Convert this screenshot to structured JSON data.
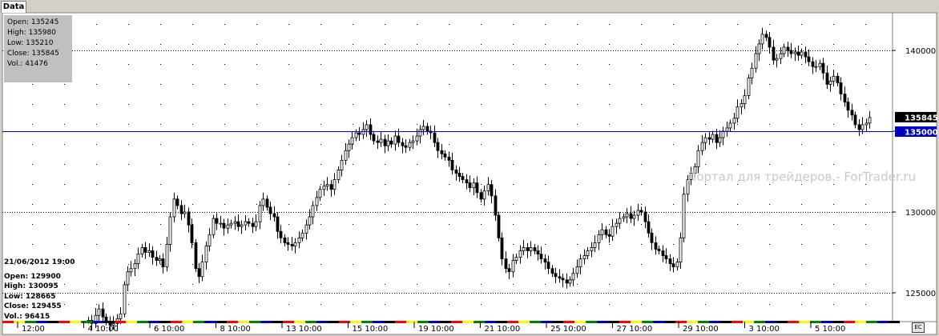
{
  "tab": {
    "label": "Data"
  },
  "data_box": {
    "rows": [
      {
        "label": "Open",
        "value": "135245"
      },
      {
        "label": "High",
        "value": "135980"
      },
      {
        "label": "Low",
        "value": "135210"
      },
      {
        "label": "Close",
        "value": "135845"
      },
      {
        "label": "Vol.",
        "value": "41476"
      }
    ]
  },
  "bar_info": {
    "date": "21/06/2012 19:00",
    "rows": [
      {
        "label": "Open",
        "value": "129900"
      },
      {
        "label": "High",
        "value": "130095"
      },
      {
        "label": "Low",
        "value": "128665"
      },
      {
        "label": "Close",
        "value": "129455"
      },
      {
        "label": "Vol.",
        "value": "96415"
      }
    ]
  },
  "watermark": "Портал для трейдеров.- ForTrader.ru",
  "corner_button": "EC",
  "colors": {
    "background": "#ffffff",
    "candle": "#000000",
    "level_line": "#0000c0",
    "current_price_bg": "#000000",
    "level_price_bg": "#0000c0"
  },
  "chart_data": {
    "type": "candlestick",
    "ylim": [
      123000,
      147000
    ],
    "y_ticks": [
      125000,
      130000,
      135000,
      140000
    ],
    "y_tick_labels": [
      "125000",
      "130000",
      "135000",
      "140000"
    ],
    "x_tick_labels": [
      "12:00",
      "4 10:00",
      "6 10:00",
      "8 10:00",
      "13 10:00",
      "15 10:00",
      "19 10:00",
      "21 10:00",
      "25 10:00",
      "27 10:00",
      "29 10:00",
      "3 10:00",
      "5 10:00"
    ],
    "current_price": 135845,
    "current_price_label": "135845",
    "level": 135000,
    "level_label": "135000",
    "grid": true,
    "close_series": [
      123300,
      123100,
      123600,
      124000,
      123500,
      123200,
      123000,
      123100,
      123400,
      123700,
      125500,
      126300,
      126500,
      126800,
      127400,
      127800,
      127500,
      127600,
      127200,
      127000,
      127100,
      126600,
      128000,
      129700,
      130800,
      130400,
      129900,
      130000,
      129200,
      128100,
      126500,
      126000,
      126900,
      127900,
      128600,
      129600,
      129300,
      129300,
      129000,
      129200,
      129300,
      129400,
      129100,
      129200,
      129400,
      129300,
      129100,
      129400,
      130400,
      130800,
      130300,
      129900,
      129700,
      128800,
      128400,
      128100,
      128000,
      127900,
      128100,
      128400,
      128700,
      129200,
      129700,
      130400,
      130900,
      131400,
      131600,
      131700,
      131400,
      132000,
      132600,
      133200,
      133800,
      134200,
      134600,
      134900,
      134800,
      135100,
      135400,
      134800,
      134400,
      134300,
      134500,
      134100,
      134400,
      134200,
      134700,
      134300,
      134100,
      134000,
      134300,
      134400,
      134700,
      135100,
      135300,
      135000,
      134900,
      134300,
      133800,
      133600,
      133400,
      133200,
      132600,
      132400,
      132200,
      132000,
      131800,
      131500,
      131800,
      131200,
      130800,
      131300,
      131700,
      131000,
      129800,
      128400,
      127100,
      126500,
      126300,
      127000,
      127200,
      127600,
      127800,
      127600,
      127800,
      127600,
      127400,
      127100,
      126900,
      126500,
      126200,
      126000,
      125900,
      125800,
      125600,
      125800,
      126200,
      126600,
      127100,
      127300,
      127600,
      127800,
      128100,
      128600,
      128900,
      128600,
      128500,
      129100,
      129300,
      129600,
      129700,
      129900,
      129600,
      129800,
      130100,
      130000,
      129400,
      128700,
      128100,
      127700,
      127600,
      127300,
      127100,
      126800,
      126600,
      126900,
      128400,
      131100,
      132000,
      132400,
      132800,
      133800,
      134300,
      134600,
      134500,
      134800,
      134300,
      134600,
      135000,
      135200,
      135500,
      135800,
      136500,
      136700,
      137200,
      138300,
      138900,
      139800,
      140400,
      141000,
      140800,
      140200,
      139400,
      139500,
      139800,
      140200,
      140000,
      139800,
      139900,
      139700,
      139900,
      139600,
      139300,
      139000,
      139000,
      139200,
      138600,
      137900,
      138100,
      138400,
      138000,
      137300,
      136800,
      136300,
      136000,
      135400,
      135100,
      135400,
      135500,
      135845
    ]
  }
}
